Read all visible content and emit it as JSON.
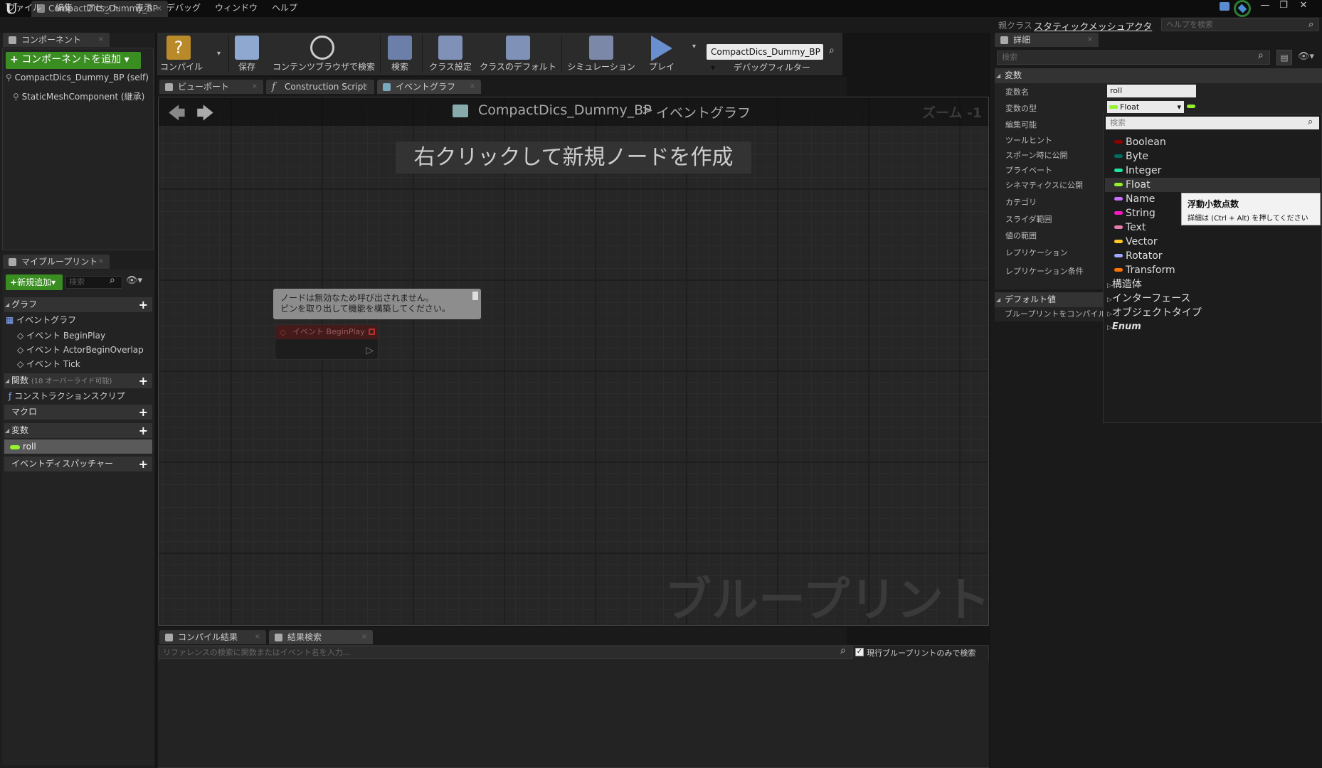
{
  "window": {
    "tab_title": "CompactDics_Dummy_BP",
    "tab_close": "×",
    "logo": "U",
    "controls": [
      "—",
      "❐",
      "✕"
    ]
  },
  "menu": {
    "items": [
      "ファイル",
      "編集",
      "アセット",
      "表示",
      "デバッグ",
      "ウィンドウ",
      "ヘルプ"
    ],
    "parent_class_label": "親クラス",
    "parent_class_value": "スタティックメッシュアクタ",
    "help_search_placeholder": "ヘルプを検索"
  },
  "components": {
    "tab": "コンポーネント",
    "add_button": "コンポーネントを追加",
    "items": [
      "CompactDics_Dummy_BP (self)",
      "StaticMeshComponent (継承)"
    ]
  },
  "my_blueprint": {
    "tab": "マイブループリント",
    "add_new": "新規追加",
    "search_placeholder": "検索",
    "graphs_label": "グラフ",
    "event_graph": "イベントグラフ",
    "events": [
      "イベント BeginPlay",
      "イベント ActorBeginOverlap",
      "イベント Tick"
    ],
    "functions_label": "関数",
    "functions_hint": "(18 オーバーライド可能)",
    "construction_script": "コンストラクションスクリプ",
    "macros_label": "マクロ",
    "variables_label": "変数",
    "variable_roll": "roll",
    "event_dispatchers_label": "イベントディスパッチャー"
  },
  "toolbar": {
    "buttons": [
      "コンパイル",
      "保存",
      "コンテンツブラウザで検索",
      "検索",
      "クラス設定",
      "クラスのデフォルト",
      "シミュレーション",
      "プレイ"
    ],
    "debug_object": "CompactDics_Dummy_BP",
    "debug_filter_label": "デバッグフィルター"
  },
  "editor_tabs": [
    "ビューポート",
    "Construction Script",
    "イベントグラフ"
  ],
  "graph": {
    "breadcrumb_bp": "CompactDics_Dummy_BP",
    "breadcrumb_sep": ">",
    "breadcrumb_graph": "イベントグラフ",
    "zoom": "ズーム -1",
    "hint": "右クリックして新規ノードを作成",
    "comment_line1": "ノードは無効なため呼び出されません。",
    "comment_line2": "ピンを取り出して機能を構築してください。",
    "node_title": "イベント BeginPlay",
    "watermark": "ブループリント"
  },
  "bottom": {
    "tabs": [
      "コンパイル結果",
      "結果検索"
    ],
    "search_placeholder": "リファレンスの検索に関数またはイベント名を入力...",
    "checkbox_label": "現行ブループリントのみで検索"
  },
  "details": {
    "tab": "詳細",
    "search_placeholder": "検索",
    "section_variable": "変数",
    "labels": [
      "変数名",
      "変数の型",
      "編集可能",
      "ツールヒント",
      "スポーン時に公開",
      "プライベート",
      "シネマティクスに公開",
      "カテゴリ",
      "スライダ範囲",
      "値の範囲",
      "レプリケーション",
      "レプリケーション条件"
    ],
    "var_name": "roll",
    "var_type": "Float",
    "section_default": "デフォルト値",
    "default_hint": "ブループリントをコンパイル"
  },
  "type_dropdown": {
    "search_placeholder": "検索",
    "types": [
      {
        "name": "Boolean",
        "color": "#8c0000"
      },
      {
        "name": "Byte",
        "color": "#006d5f"
      },
      {
        "name": "Integer",
        "color": "#1fe2a5"
      },
      {
        "name": "Float",
        "color": "#94f22f"
      },
      {
        "name": "Name",
        "color": "#c971ff"
      },
      {
        "name": "String",
        "color": "#ff19c5"
      },
      {
        "name": "Text",
        "color": "#e87bac"
      },
      {
        "name": "Vector",
        "color": "#ffc826"
      },
      {
        "name": "Rotator",
        "color": "#a1a8ff"
      },
      {
        "name": "Transform",
        "color": "#ff7300"
      }
    ],
    "groups": [
      "構造体",
      "インターフェース",
      "オブジェクトタイプ",
      "Enum"
    ],
    "tooltip_title": "浮動小数点数",
    "tooltip_hint": "詳細は (Ctrl + Alt) を押してください"
  }
}
